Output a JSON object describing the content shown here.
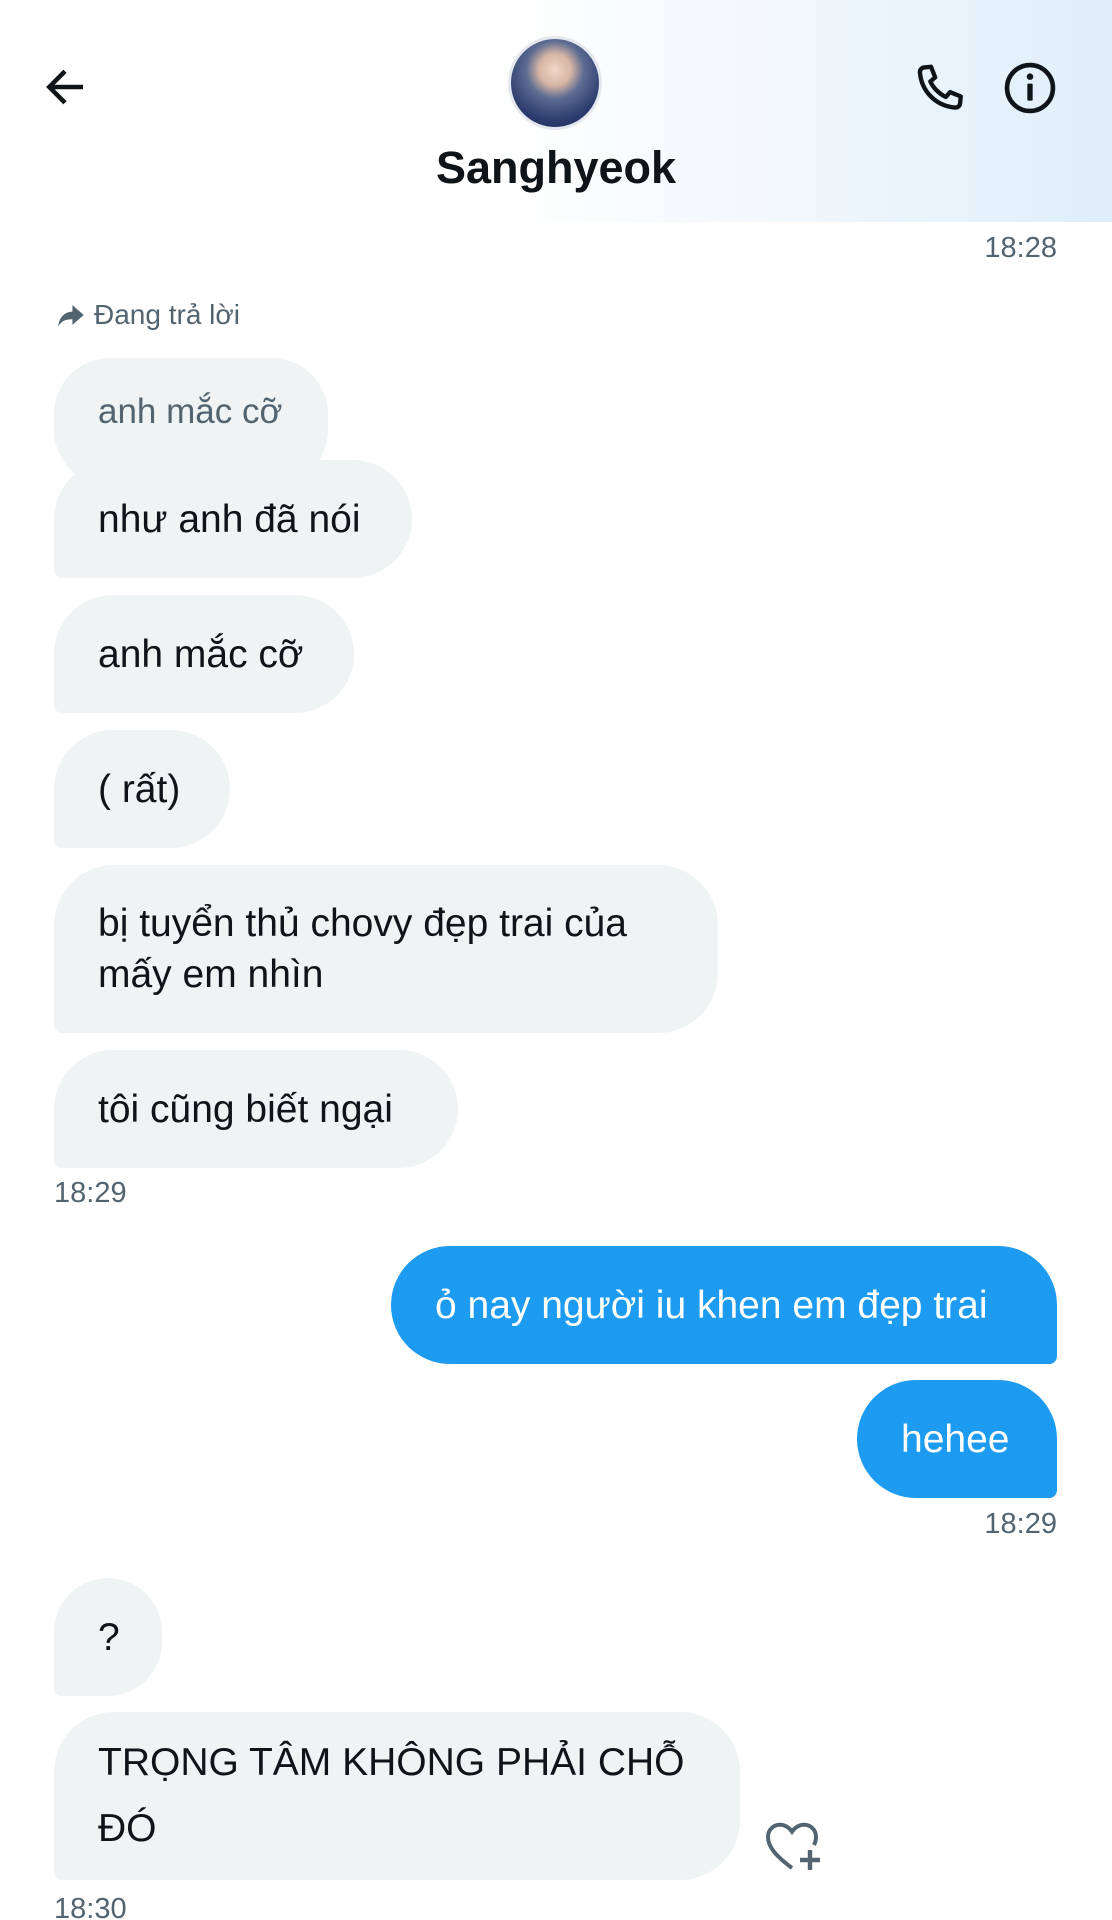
{
  "header": {
    "contact_name": "Sanghyeok",
    "back_icon": "arrow-left-icon",
    "call_icon": "phone-icon",
    "info_icon": "info-icon"
  },
  "thread": {
    "timestamp_top": "18:28",
    "reply_indicator": "Đang trả lời",
    "quoted_message": "anh mắc cỡ",
    "incoming_1": [
      "như anh đã nói",
      "anh mắc cỡ",
      "( rất)",
      "bị tuyển thủ chovy đẹp trai của mấy em nhìn",
      "tôi cũng biết ngại"
    ],
    "timestamp_incoming_1": "18:29",
    "outgoing": [
      "ỏ nay người iu khen em đẹp trai",
      "hehee"
    ],
    "timestamp_outgoing": "18:29",
    "incoming_2": [
      "?",
      "TRỌNG TÂM KHÔNG PHẢI CHỖ ĐÓ"
    ],
    "timestamp_incoming_2": "18:30",
    "add_reaction_icon": "heart-plus-icon"
  },
  "colors": {
    "outgoing_bubble": "#1d9bf0",
    "incoming_bubble": "#eff3f4",
    "secondary_text": "#536471"
  }
}
